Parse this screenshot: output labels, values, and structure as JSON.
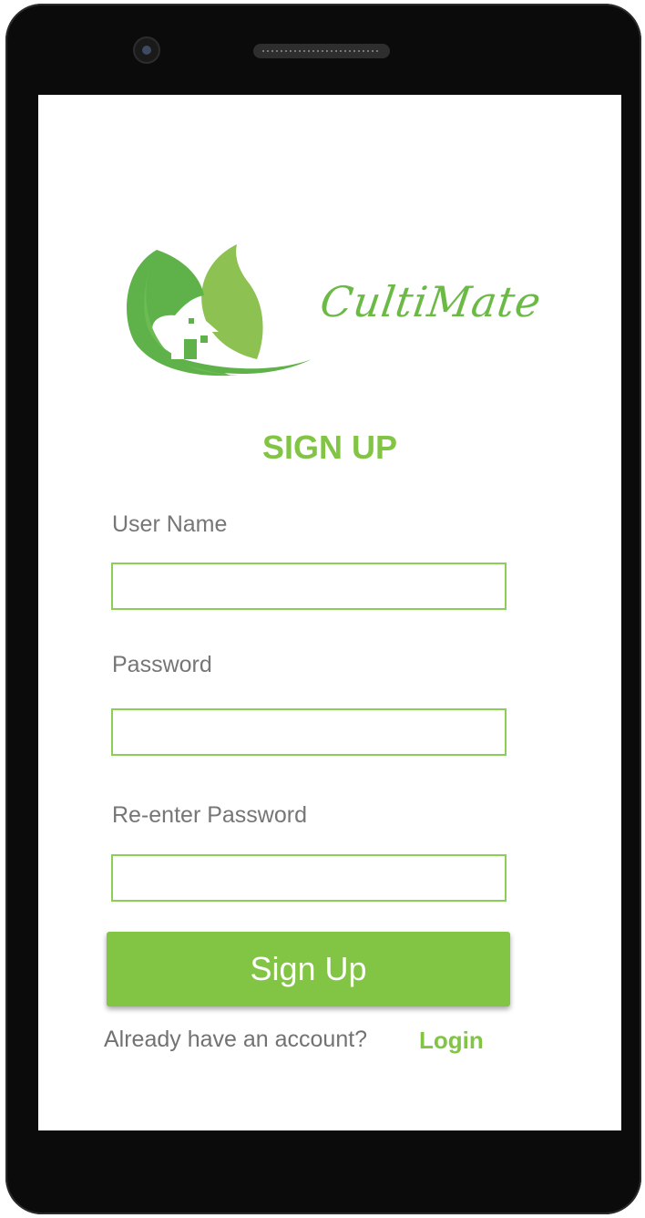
{
  "app": {
    "brand_name": "CultiMate"
  },
  "form": {
    "title": "SIGN UP",
    "username_label": "User Name",
    "username_value": "",
    "password_label": "Password",
    "password_value": "",
    "reenter_label": "Re-enter Password",
    "reenter_value": "",
    "submit_label": "Sign Up"
  },
  "footer": {
    "prompt": "Already have an account?",
    "login_label": "Login"
  },
  "colors": {
    "accent": "#82c545",
    "leaf_dark": "#5fb24a",
    "leaf_light": "#8dc152",
    "text_gray": "#767676"
  },
  "icons": [
    "camera-icon",
    "speaker-grille",
    "leaf-house-logo-icon"
  ]
}
